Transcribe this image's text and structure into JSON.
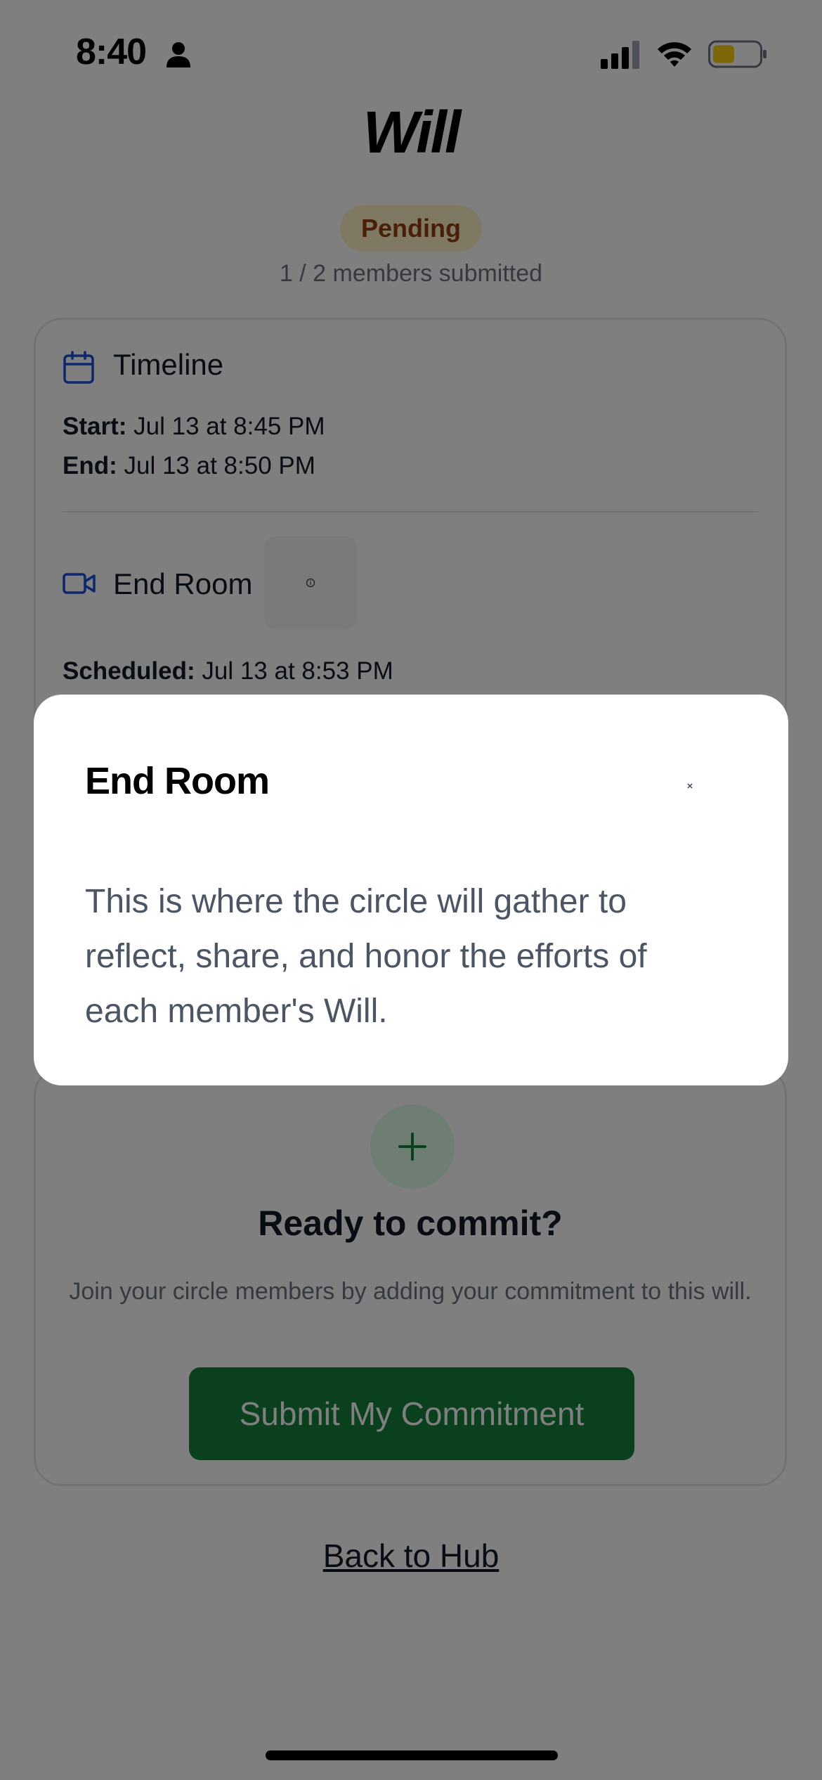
{
  "status_bar": {
    "time": "8:40"
  },
  "header": {
    "title": "Will",
    "status_badge": "Pending",
    "members_submitted": "1 / 2 members submitted"
  },
  "timeline": {
    "title": "Timeline",
    "start_label": "Start:",
    "start_value": "Jul 13 at 8:45 PM",
    "end_label": "End:",
    "end_value": "Jul 13 at 8:50 PM"
  },
  "end_room": {
    "title": "End Room",
    "scheduled_label": "Scheduled:",
    "scheduled_value": "Jul 13 at 8:53 PM"
  },
  "commit": {
    "title": "Ready to commit?",
    "description": "Join your circle members by adding your commitment to this will.",
    "submit_label": "Submit My Commitment"
  },
  "back_link": "Back to Hub",
  "modal": {
    "title": "End Room",
    "body": "This is where the circle will gather to reflect, share, and honor the efforts of each member's Will."
  },
  "colors": {
    "accent_blue": "#1d4ed8",
    "pending_bg": "#fef3c7",
    "pending_text": "#92400e",
    "submit_green": "#15803d",
    "battery_yellow": "#facc15"
  },
  "icons": {
    "person": "person-icon",
    "signal": "cellular-signal-icon",
    "wifi": "wifi-icon",
    "battery": "battery-icon",
    "calendar": "calendar-icon",
    "video": "video-camera-icon",
    "info": "info-icon",
    "plus": "plus-icon",
    "close": "close-icon"
  }
}
